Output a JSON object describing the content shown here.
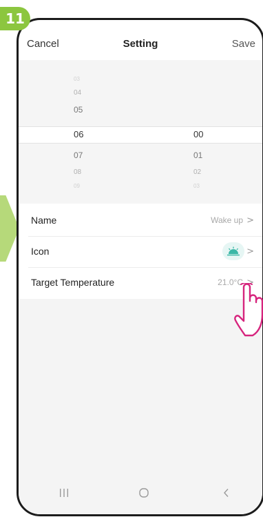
{
  "step": {
    "number": "11"
  },
  "header": {
    "cancel_label": "Cancel",
    "title": "Setting",
    "save_label": "Save"
  },
  "picker": {
    "hours": [
      "03",
      "04",
      "05",
      "06",
      "07",
      "08",
      "09"
    ],
    "minutes": [
      "00",
      "01",
      "02",
      "03"
    ],
    "selected_hour": "06",
    "selected_minute": "00"
  },
  "settings": {
    "name": {
      "label": "Name",
      "value": "Wake up"
    },
    "icon": {
      "label": "Icon",
      "icon_name": "sunrise-icon",
      "icon_color": "#3ab7a6"
    },
    "target_temperature": {
      "label": "Target Temperature",
      "value": "21.0°C"
    }
  },
  "chevron": ">",
  "nav": {
    "recents_icon": "recents-icon",
    "home_icon": "home-icon",
    "back_icon": "back-icon"
  },
  "colors": {
    "badge": "#8cc63f",
    "arrow": "#b6d97a",
    "hand": "#d6247d"
  }
}
